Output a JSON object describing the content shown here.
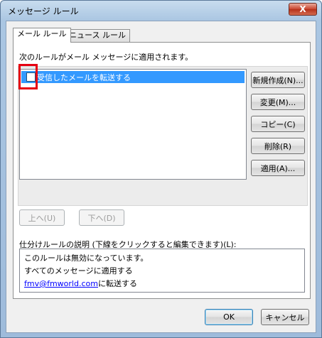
{
  "window": {
    "title": "メッセージ ルール",
    "close_label": "X"
  },
  "tabs": [
    {
      "label": "メール ルール",
      "active": true
    },
    {
      "label": "ニュース ルール",
      "active": false
    }
  ],
  "rules_header": "次のルールがメール メッセージに適用されます。",
  "rules": [
    {
      "label": "受信したメールを転送する",
      "checked": false,
      "selected": true
    }
  ],
  "side_buttons": {
    "new": "新規作成(N)...",
    "modify": "変更(M)...",
    "copy": "コピー(C)",
    "delete": "削除(R)",
    "apply": "適用(A)..."
  },
  "move_buttons": {
    "up": "上へ(U)",
    "down": "下へ(D)"
  },
  "description": {
    "label": "仕分けルールの説明 (下線をクリックすると編集できます)(L):",
    "line1": "このルールは無効になっています。",
    "line2": "すべてのメッセージに適用する",
    "line3_link": "fmv@fmworld.com",
    "line3_suffix": "に転送する"
  },
  "footer": {
    "ok": "OK",
    "cancel": "キャンセル"
  },
  "colors": {
    "selection": "#3399ff",
    "highlight_box": "#e60012",
    "link": "#0000ff"
  }
}
